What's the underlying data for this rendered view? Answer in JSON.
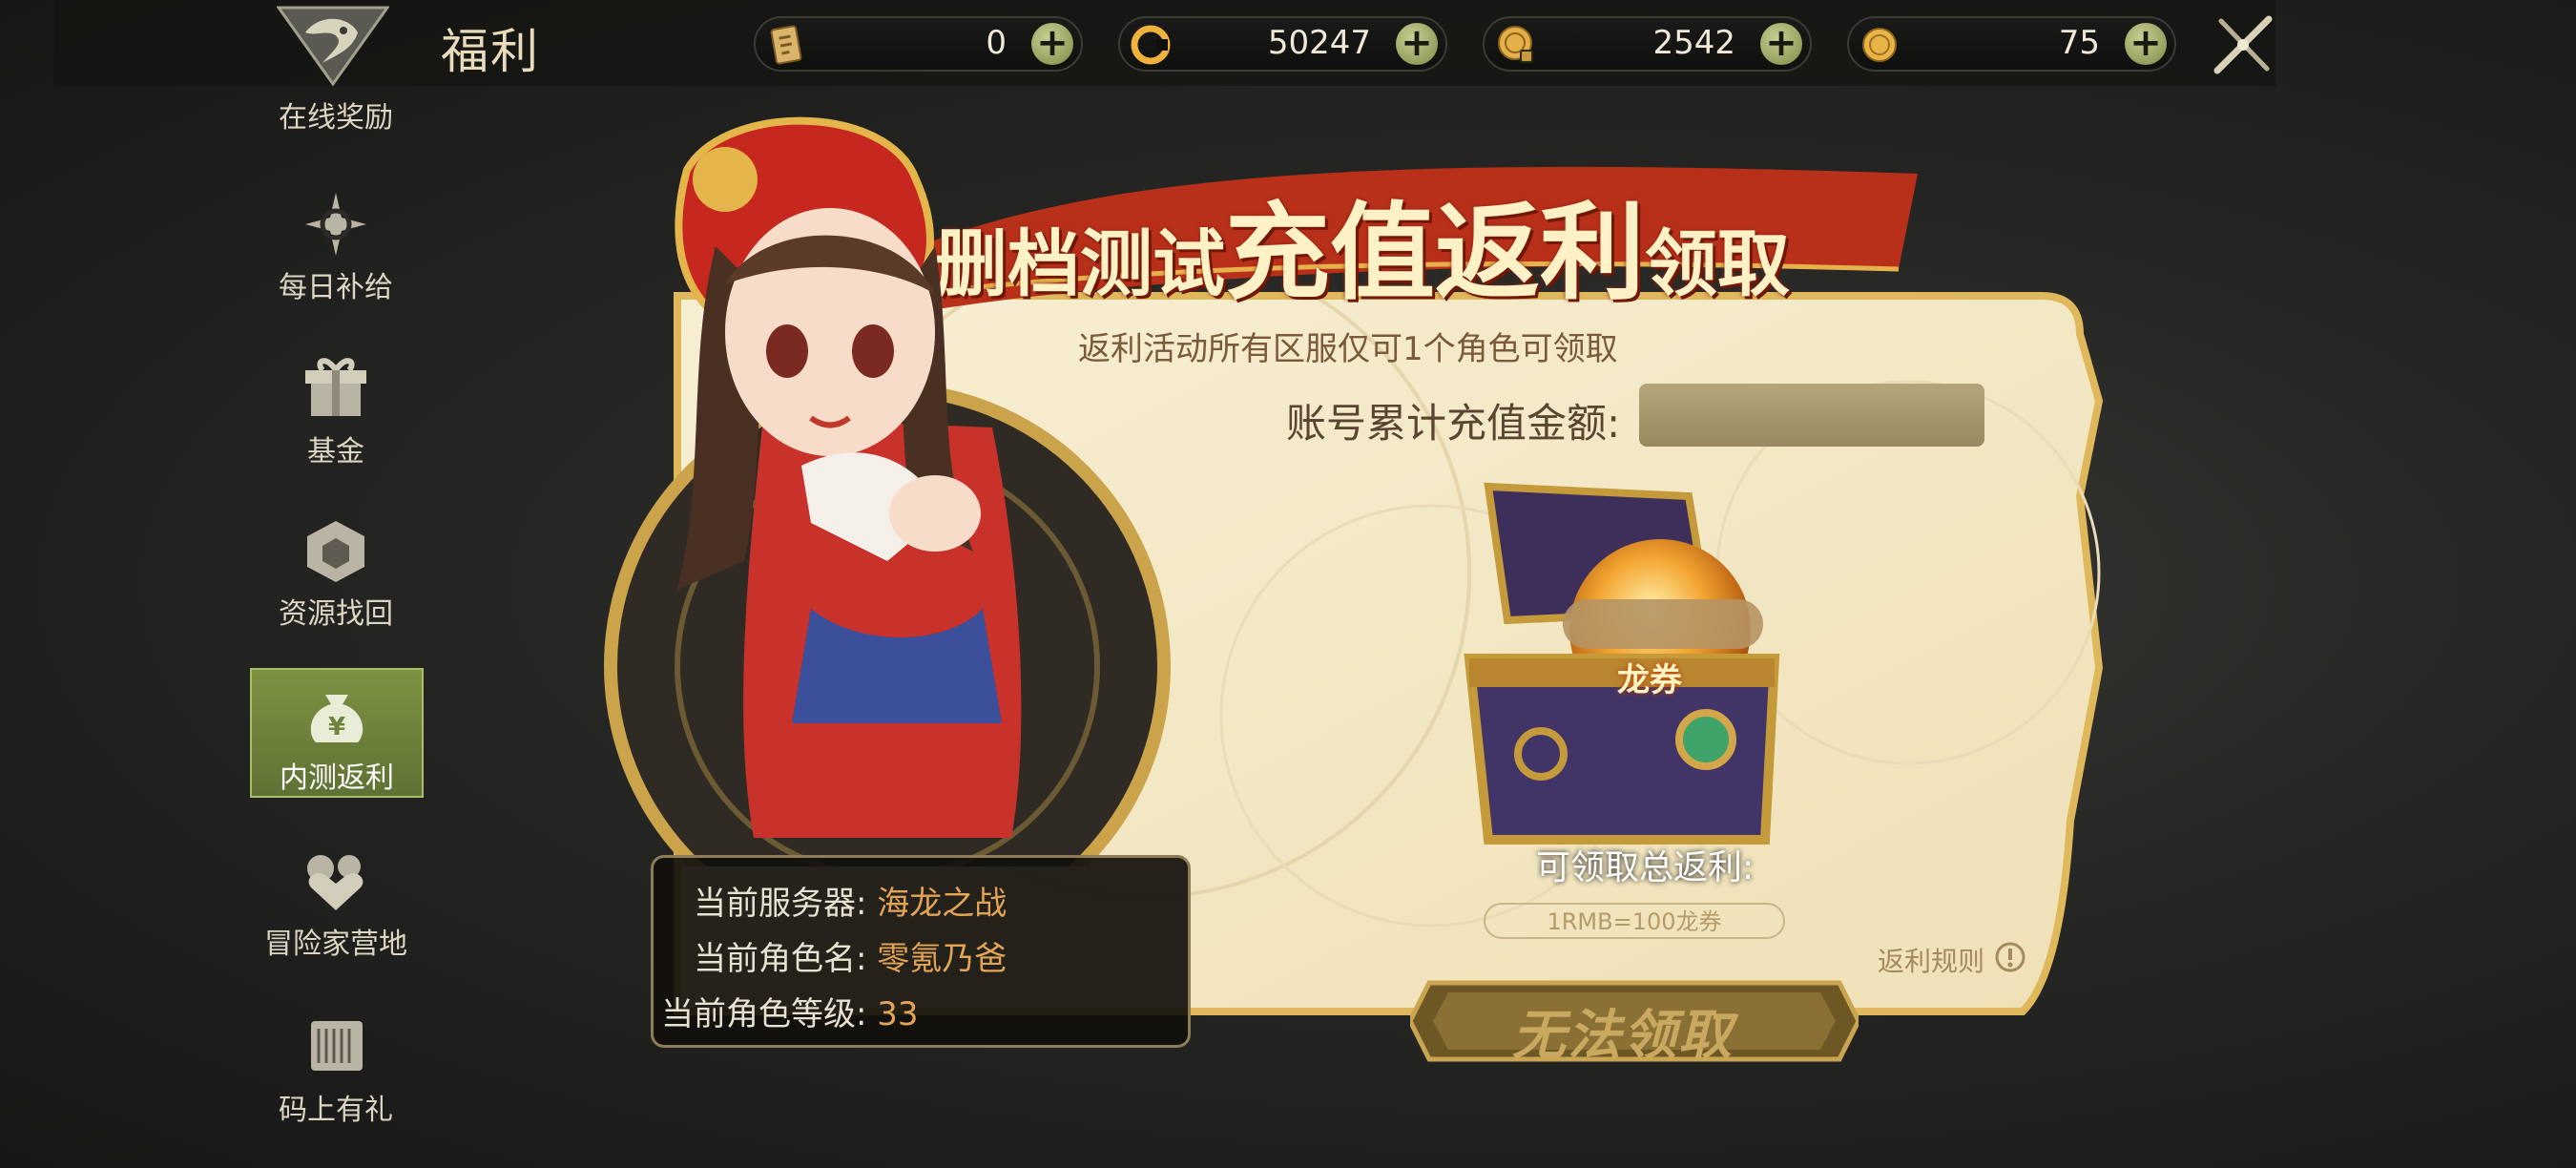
{
  "header": {
    "title": "福利",
    "currencies": [
      {
        "icon": "card-ticket-icon",
        "value": "0"
      },
      {
        "icon": "c-coin-icon",
        "value": "50247"
      },
      {
        "icon": "locked-gold-coin-icon",
        "value": "2542"
      },
      {
        "icon": "gold-coin-icon",
        "value": "75"
      }
    ]
  },
  "sidebar": {
    "items": [
      {
        "label": "在线奖励",
        "icon": "dragon-emblem-icon"
      },
      {
        "label": "每日补给",
        "icon": "compass-c-icon"
      },
      {
        "label": "基金",
        "icon": "gift-box-icon"
      },
      {
        "label": "资源找回",
        "icon": "recycle-cube-icon"
      },
      {
        "label": "内测返利",
        "icon": "money-bag-icon",
        "active": true
      },
      {
        "label": "冒险家营地",
        "icon": "camp-heart-icon"
      },
      {
        "label": "码上有礼",
        "icon": "gift-code-icon"
      }
    ]
  },
  "event": {
    "title_part1": "删档测试",
    "title_part2": "充值返利",
    "title_part3": "领取",
    "notice": "返利活动所有区服仅可1个角色可领取",
    "account_label": "账号累计充值金额:",
    "account_value": "",
    "voucher_label": "龙券",
    "total_label": "可领取总返利:",
    "rate": "1RMB=100龙券",
    "rules_link": "返利规则",
    "claim_button": "无法领取"
  },
  "player": {
    "server_label": "当前服务器:",
    "server_value": "海龙之战",
    "role_label": "当前角色名:",
    "role_value": "零氪乃爸",
    "level_label": "当前角色等级:",
    "level_value": "33"
  },
  "colors": {
    "active_tab": "#6e833b",
    "accent_orange": "#e3a456",
    "title_red": "#b8301a",
    "panel_cream": "#f3e8c6"
  }
}
